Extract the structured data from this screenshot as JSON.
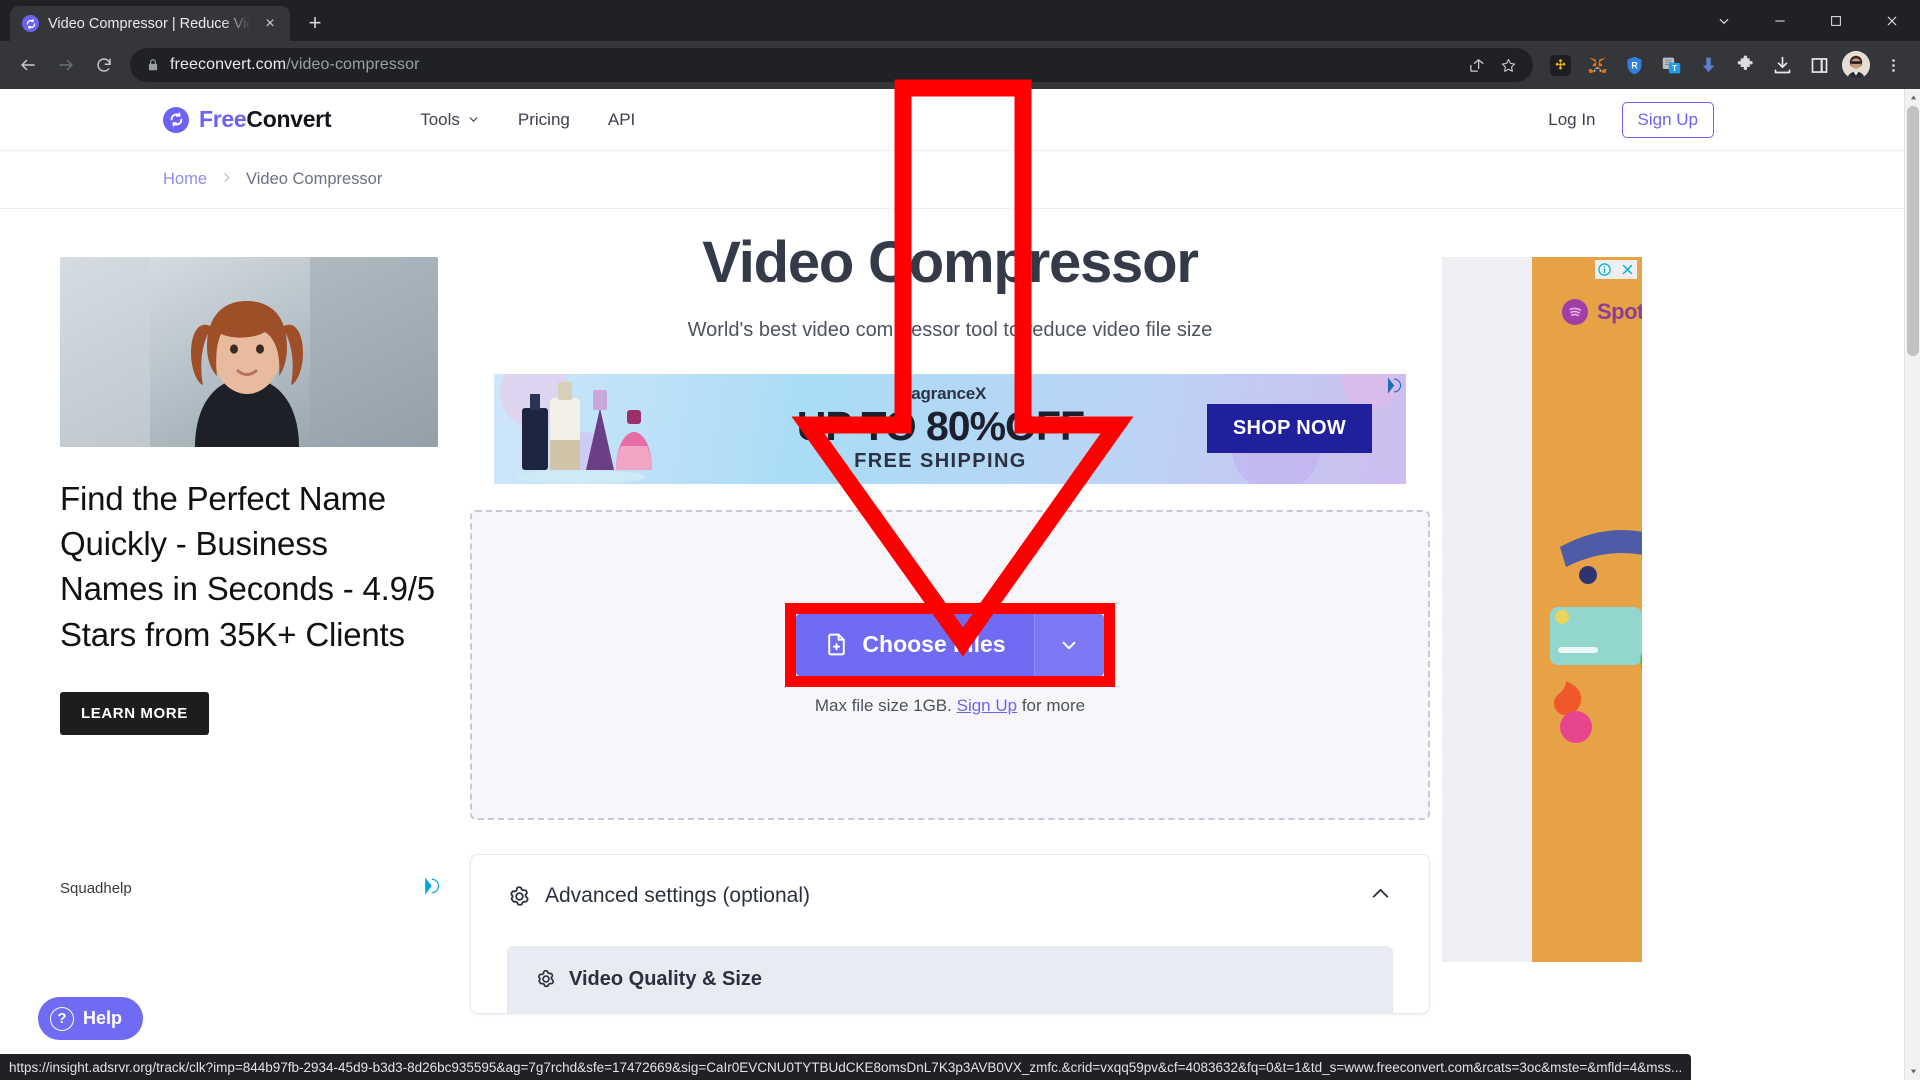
{
  "browser": {
    "tab": {
      "title": "Video Compressor | Reduce Vide",
      "favicon": "freeconvert-favicon",
      "close": "×"
    },
    "new_tab_label": "+",
    "window_controls": {
      "minimize_all": "chevron-down",
      "minimize": "minimize",
      "maximize": "maximize",
      "close": "close"
    },
    "nav": {
      "back": "back-arrow",
      "forward": "forward-arrow",
      "reload": "reload"
    },
    "omnibox": {
      "lock": "site-secure-lock",
      "url_domain": "freeconvert.com",
      "url_path": "/video-compressor",
      "share": "share-icon",
      "bookmark": "star-icon"
    },
    "extensions": [
      {
        "name": "binance-extension"
      },
      {
        "name": "metamask-extension"
      },
      {
        "name": "rabby-wallet-extension"
      },
      {
        "name": "text-tool-extension"
      },
      {
        "name": "download-arrow-extension"
      },
      {
        "name": "puzzle-extensions-menu"
      },
      {
        "name": "downloads-button"
      },
      {
        "name": "side-panel-button"
      }
    ],
    "profile": "user-avatar",
    "menu": "chrome-menu-dots",
    "status_url": "https://insight.adsrvr.org/track/clk?imp=844b97fb-2934-45d9-b3d3-8d26bc935595&ag=7g7rchd&sfe=17472669&sig=CaIr0EVCNU0TYTBUdCKE8omsDnL7K3p3AVB0VX_zmfc.&crid=vxqq59pv&cf=4083632&fq=0&t=1&td_s=www.freeconvert.com&rcats=3oc&mste=&mfld=4&mss..."
  },
  "site": {
    "logo": {
      "free": "Free",
      "convert": "Convert"
    },
    "nav": [
      {
        "label": "Tools",
        "caret": "chevron-down-icon"
      },
      {
        "label": "Pricing"
      },
      {
        "label": "API"
      }
    ],
    "login_label": "Log In",
    "signup_label": "Sign Up",
    "breadcrumb": {
      "home": "Home",
      "separator": "›",
      "current": "Video Compressor"
    }
  },
  "main": {
    "title": "Video Compressor",
    "subtitle": "World's best video compressor tool to reduce video file size",
    "choose_files_label": "Choose Files",
    "choose_files_icon": "file-plus-icon",
    "choose_files_caret": "chevron-down-icon",
    "max_file_prefix": "Max file size 1GB.",
    "max_file_link": "Sign Up",
    "max_file_suffix": "for more",
    "advanced_settings_label": "Advanced settings (optional)",
    "advanced_settings_icon": "gear-icon",
    "advanced_settings_chevron": "chevron-up-icon",
    "video_quality_label": "Video Quality & Size",
    "video_quality_icon": "gear-icon"
  },
  "ads": {
    "left": {
      "headline": "Find the Perfect Name Quickly - Business Names in Seconds - 4.9/5 Stars from 35K+ Clients",
      "cta": "LEARN MORE",
      "advertiser": "Squadhelp",
      "adchoices": "adchoices-icon",
      "image_alt": "woman-portrait-photo"
    },
    "banner": {
      "brand": "FragranceX",
      "headline": "UP TO 80%OFF",
      "subline": "FREE SHIPPING",
      "cta": "SHOP NOW",
      "adchoices": "adchoices-icon"
    },
    "right": {
      "brand": "Spotify",
      "info_icon": "ad-info-icon",
      "close_icon": "ad-close-icon"
    }
  },
  "widgets": {
    "help_label": "Help",
    "help_icon": "question-mark-icon"
  },
  "colors": {
    "accent": "#6c63f5",
    "button": "#6f6bf2",
    "annotation_red": "#fe0000",
    "chrome_dark": "#202124",
    "toolbar": "#35363a"
  }
}
